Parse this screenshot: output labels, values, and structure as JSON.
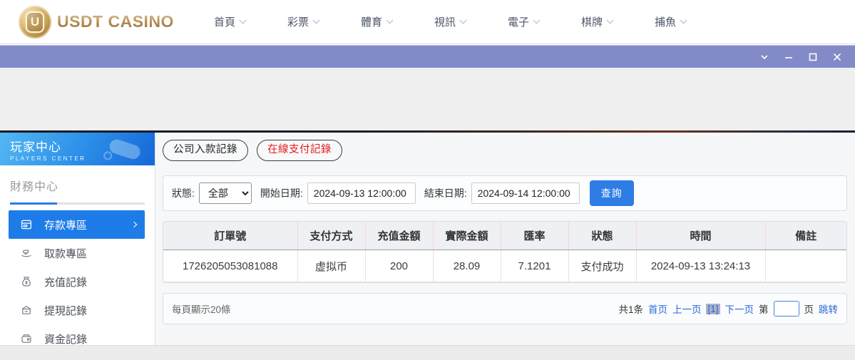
{
  "header": {
    "logo": {
      "monogram": "U",
      "wordmark": "USDT CASINO"
    },
    "nav": [
      {
        "label": "首頁"
      },
      {
        "label": "彩票"
      },
      {
        "label": "體育"
      },
      {
        "label": "視訊"
      },
      {
        "label": "電子"
      },
      {
        "label": "棋牌"
      },
      {
        "label": "捕魚"
      }
    ]
  },
  "titlebar": {
    "controls": [
      "chevron-down-icon",
      "minimize-icon",
      "maximize-icon",
      "close-icon"
    ]
  },
  "sidebar": {
    "title": "玩家中心",
    "subtitle": "PLAYERS CENTER",
    "section": "財務中心",
    "items": [
      {
        "label": "存款專區",
        "icon": "deposit-icon",
        "active": true
      },
      {
        "label": "取款專區",
        "icon": "withdraw-icon",
        "active": false
      },
      {
        "label": "充值記錄",
        "icon": "recharge-record-icon",
        "active": false
      },
      {
        "label": "提現記錄",
        "icon": "withdrawal-record-icon",
        "active": false
      },
      {
        "label": "資金記錄",
        "icon": "funds-record-icon",
        "active": false
      }
    ]
  },
  "main": {
    "tabs": [
      {
        "label": "公司入款記錄",
        "active": false
      },
      {
        "label": "在線支付記錄",
        "active": true
      }
    ],
    "filters": {
      "status_label": "狀態:",
      "status_value": "全部",
      "start_label": "開始日期:",
      "start_value": "2024-09-13 12:00:00",
      "end_label": "結束日期:",
      "end_value": "2024-09-14 12:00:00",
      "search_label": "查詢"
    },
    "table": {
      "columns": [
        "訂單號",
        "支付方式",
        "充值金額",
        "實際金額",
        "匯率",
        "狀態",
        "時間",
        "備註"
      ],
      "rows": [
        [
          "1726205053081088",
          "虚拟币",
          "200",
          "28.09",
          "7.1201",
          "支付成功",
          "2024-09-13 13:24:13",
          ""
        ]
      ]
    },
    "pagination": {
      "page_size_text": "每頁顯示20條",
      "total_text": "共1条",
      "first_label": "首页",
      "prev_label": "上一页",
      "current_label": "[1]",
      "next_label": "下一页",
      "jump_prefix": "第",
      "jump_suffix": "页",
      "jump_label": "跳转"
    }
  },
  "colors": {
    "accent_blue": "#2e7ce5",
    "active_menu_blue": "#1e7ce8",
    "titlebar_purple": "#828ac8",
    "tab_active_red": "#e51c1c",
    "gold": "#b18953",
    "table_separator_pink": "#f3d8d8",
    "sidebar_gradient_start": "#53b7f3",
    "sidebar_gradient_end": "#1568d8"
  }
}
